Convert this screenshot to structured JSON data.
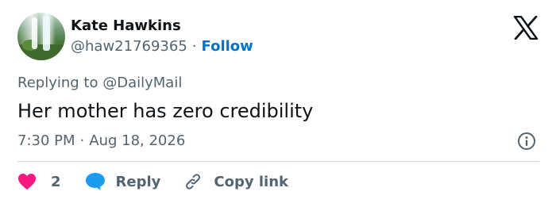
{
  "user": {
    "name": "Kate Hawkins",
    "handle": "@haw21769365",
    "separator": "·",
    "follow_label": "Follow"
  },
  "reply_context": {
    "prefix": "Replying to",
    "mention": "@DailyMail"
  },
  "tweet": {
    "text": "Her mother has zero credibility"
  },
  "meta": {
    "time": "7:30 PM",
    "separator": "·",
    "date": "Aug 18, 2026"
  },
  "actions": {
    "like_count": "2",
    "reply_label": "Reply",
    "copy_label": "Copy link"
  },
  "icons": {
    "logo": "x-logo-icon",
    "info": "info-icon",
    "like": "heart-icon",
    "reply": "speech-bubble-icon",
    "copy": "link-icon"
  },
  "colors": {
    "heart": "#f91880",
    "reply_bubble": "#1d9bf0",
    "follow": "#0074c8",
    "secondary_text": "#536471"
  }
}
